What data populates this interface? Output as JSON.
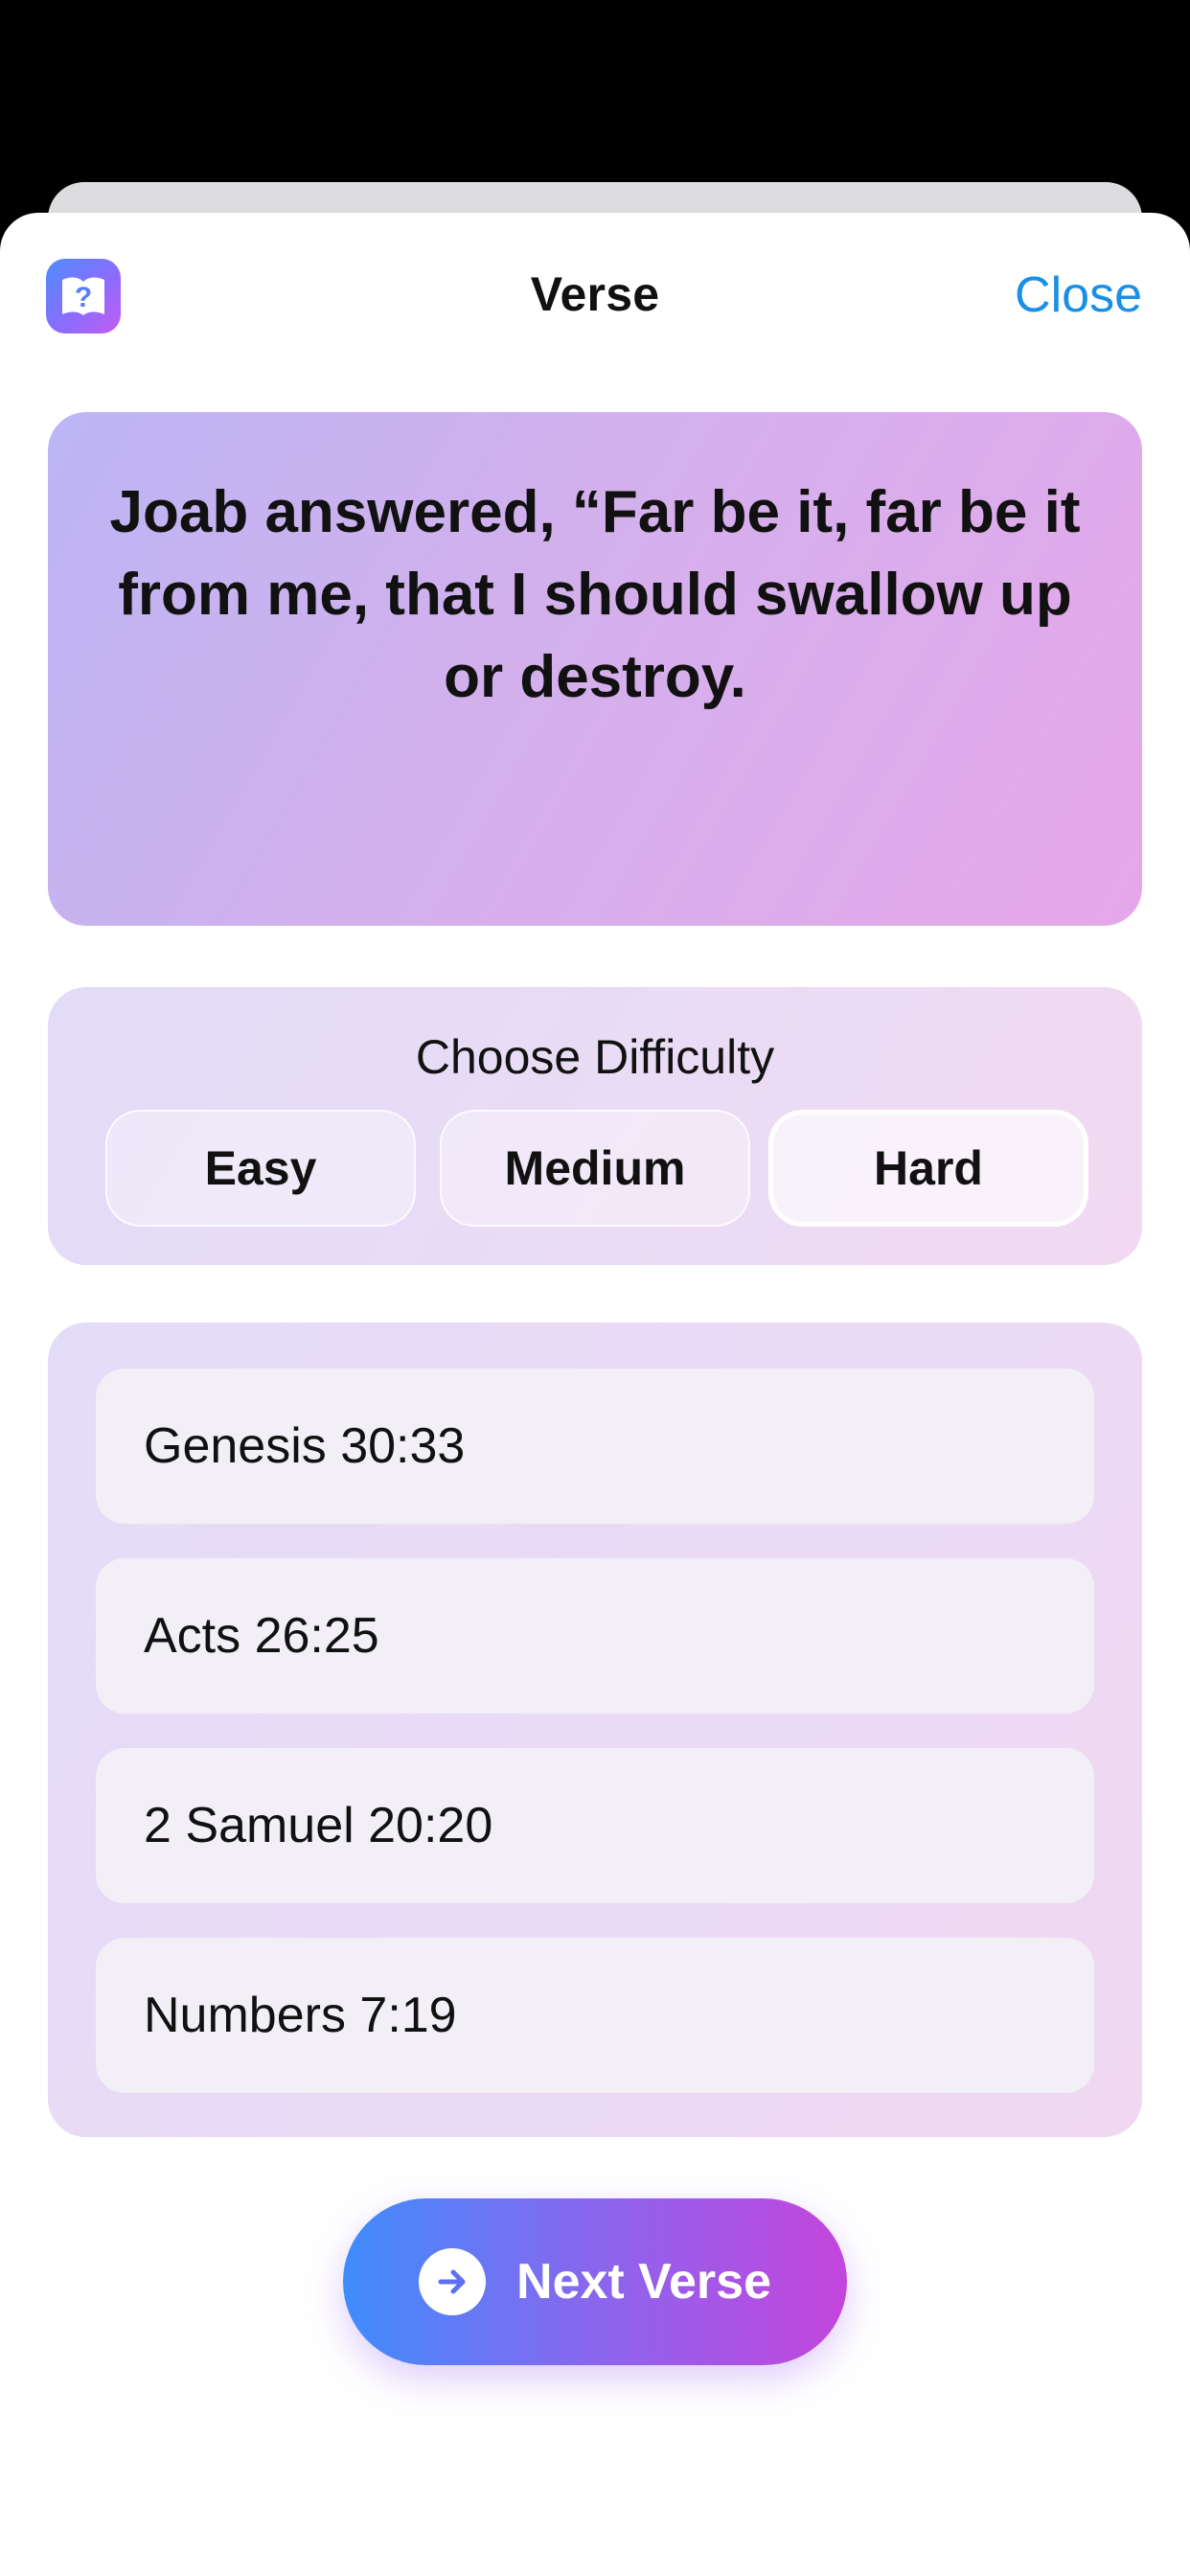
{
  "header": {
    "title": "Verse",
    "close_label": "Close",
    "app_icon": "book-question-icon"
  },
  "verse": {
    "text": "Joab answered, “Far be it, far be it from me, that I should swallow up or destroy."
  },
  "difficulty": {
    "label": "Choose Difficulty",
    "options": [
      "Easy",
      "Medium",
      "Hard"
    ],
    "selected": "Hard"
  },
  "answers": [
    "Genesis 30:33",
    "Acts 26:25",
    "2 Samuel 20:20",
    "Numbers 7:19"
  ],
  "next_button": {
    "label": "Next Verse",
    "icon": "arrow-right-circle-icon"
  },
  "colors": {
    "accent_blue": "#1a8fe6",
    "gradient_start": "#3f8cfb",
    "gradient_end": "#c445dc"
  }
}
